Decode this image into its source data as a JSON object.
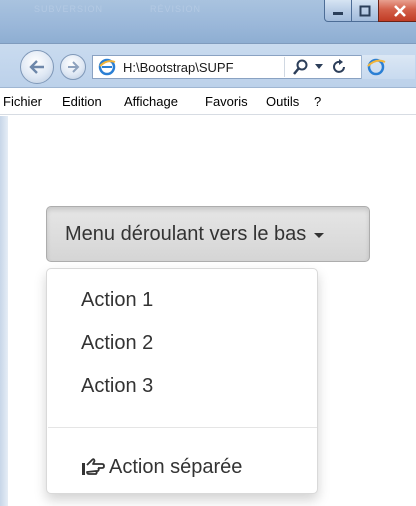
{
  "window": {
    "ghost_tabs": [
      "SUBVERSION",
      "RÉVISION"
    ]
  },
  "address_bar": {
    "url": "H:\\Bootstrap\\SUPF"
  },
  "menubar": {
    "items": [
      "Fichier",
      "Edition",
      "Affichage",
      "Favoris",
      "Outils",
      "?"
    ]
  },
  "dropdown": {
    "button_label": "Menu déroulant vers le bas",
    "items": [
      "Action 1",
      "Action 2",
      "Action 3"
    ],
    "separated_item": "Action séparée"
  }
}
